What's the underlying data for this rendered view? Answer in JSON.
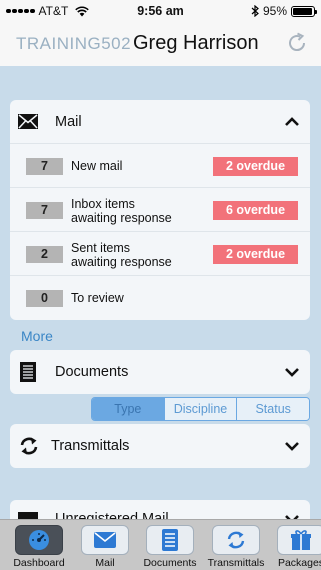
{
  "status_bar": {
    "carrier": "AT&T",
    "time": "9:56 am",
    "battery": "95%",
    "battery_level": 0.95
  },
  "header": {
    "org_code": "TRAINING502",
    "user_name": "Greg Harrison"
  },
  "mail": {
    "title": "Mail",
    "rows": [
      {
        "count": "7",
        "label_lines": [
          "New mail"
        ],
        "overdue": "2 overdue"
      },
      {
        "count": "7",
        "label_lines": [
          "Inbox items",
          "awaiting response"
        ],
        "overdue": "6 overdue"
      },
      {
        "count": "2",
        "label_lines": [
          "Sent items",
          "awaiting response"
        ],
        "overdue": "2 overdue"
      },
      {
        "count": "0",
        "label_lines": [
          "To review"
        ],
        "overdue": ""
      }
    ]
  },
  "more_link": "More",
  "documents": {
    "title": "Documents",
    "segments": [
      "Type",
      "Discipline",
      "Status"
    ],
    "selected_segment": "Type"
  },
  "transmittals": {
    "title": "Transmittals"
  },
  "unregistered_mail": {
    "title": "Unregistered Mail"
  },
  "tab_bar": {
    "tabs": [
      {
        "label": "Dashboard",
        "icon": "dashboard-icon",
        "active": true
      },
      {
        "label": "Mail",
        "icon": "mail-icon",
        "active": false
      },
      {
        "label": "Documents",
        "icon": "documents-icon",
        "active": false
      },
      {
        "label": "Transmittals",
        "icon": "transmittals-icon",
        "active": false
      },
      {
        "label": "Packages",
        "icon": "packages-icon",
        "active": false
      }
    ]
  },
  "colors": {
    "background": "#c8dbea",
    "overdue": "#f2727a",
    "link": "#3a86c6",
    "segment_accent": "#6ba8e2"
  }
}
